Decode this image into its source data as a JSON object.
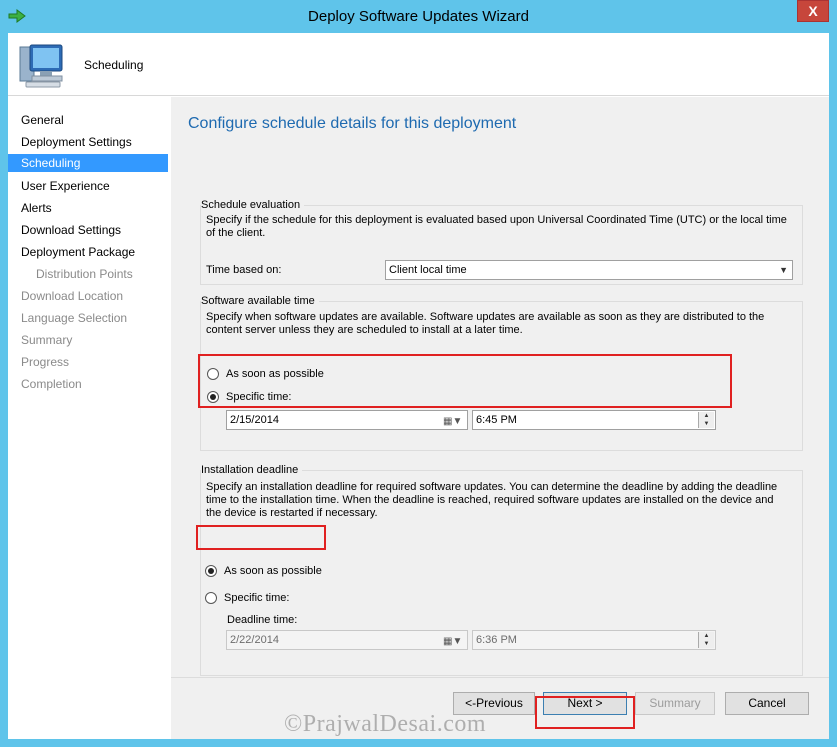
{
  "window": {
    "title": "Deploy Software Updates Wizard",
    "close_glyph": "X"
  },
  "header": {
    "title": "Scheduling",
    "icon": "computer-monitor-icon"
  },
  "nav": {
    "items": [
      {
        "label": "General",
        "state": "normal"
      },
      {
        "label": "Deployment Settings",
        "state": "normal"
      },
      {
        "label": "Scheduling",
        "state": "active"
      },
      {
        "label": "User Experience",
        "state": "normal"
      },
      {
        "label": "Alerts",
        "state": "normal"
      },
      {
        "label": "Download Settings",
        "state": "normal"
      },
      {
        "label": "Deployment Package",
        "state": "normal"
      },
      {
        "label": "Distribution Points",
        "state": "dim"
      },
      {
        "label": "Download Location",
        "state": "dim"
      },
      {
        "label": "Language Selection",
        "state": "dim"
      },
      {
        "label": "Summary",
        "state": "dim"
      },
      {
        "label": "Progress",
        "state": "dim"
      },
      {
        "label": "Completion",
        "state": "dim"
      }
    ]
  },
  "main": {
    "heading": "Configure schedule details for this deployment",
    "schedule_evaluation": {
      "title": "Schedule evaluation",
      "description": "Specify if the schedule for this deployment is evaluated based upon Universal Coordinated Time (UTC) or the local time of the client.",
      "time_based_label": "Time based on:",
      "time_based_value": "Client local time"
    },
    "available_time": {
      "title": "Software available time",
      "description": "Specify when software updates are available. Software updates are available as soon as they are distributed to the content server unless they are scheduled to install at a later time.",
      "asap_label": "As soon as possible",
      "specific_label": "Specific time:",
      "date_value": "2/15/2014",
      "time_value": "6:45 PM"
    },
    "deadline": {
      "title": "Installation deadline",
      "description": "Specify an installation deadline for required software updates. You can determine the deadline by adding the deadline time to the installation time. When the deadline is reached, required software updates are installed on the device and the device is restarted if necessary.",
      "asap_label": "As soon as possible",
      "specific_label": "Specific time:",
      "deadline_time_label": "Deadline time:",
      "date_value": "2/22/2014",
      "time_value": "6:36 PM"
    }
  },
  "footer": {
    "previous_label": "<-Previous",
    "next_label": "Next >",
    "summary_label": "Summary",
    "cancel_label": "Cancel"
  },
  "watermark": "©PrajwalDesai.com",
  "colors": {
    "titlebar": "#5fc4ea",
    "active_nav": "#3399ff",
    "heading": "#1e6ab0",
    "highlight": "#e02020"
  }
}
